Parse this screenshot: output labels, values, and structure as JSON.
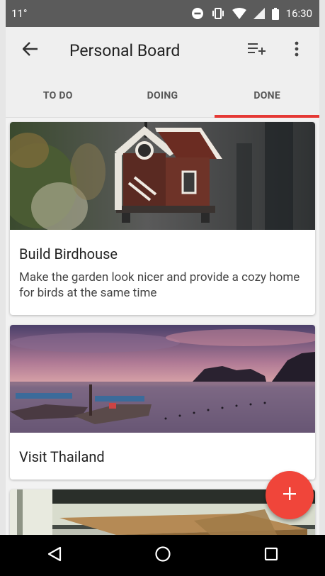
{
  "status_bar": {
    "temperature": "11°",
    "time": "16:30",
    "icons": [
      "do-not-disturb-icon",
      "vibrate-icon",
      "wifi-icon",
      "signal-icon",
      "battery-icon"
    ]
  },
  "app_bar": {
    "title": "Personal Board",
    "icons": [
      "back-arrow-icon",
      "playlist-add-icon",
      "more-vert-icon"
    ]
  },
  "tabs": [
    {
      "label": "TO DO",
      "active": false
    },
    {
      "label": "DOING",
      "active": false
    },
    {
      "label": "DONE",
      "active": true
    }
  ],
  "cards": [
    {
      "title": "Build Birdhouse",
      "description": "Make the garden look nicer and provide a cozy home for birds at the same time",
      "image": "birdhouse-photo"
    },
    {
      "title": "Visit Thailand",
      "description": "",
      "image": "thailand-boats-photo"
    },
    {
      "title": "",
      "description": "",
      "image": "patio-table-photo"
    }
  ],
  "fab": {
    "icon": "plus-icon"
  },
  "nav_bar": {
    "icons": [
      "back-triangle-icon",
      "home-circle-icon",
      "recents-square-icon"
    ]
  },
  "colors": {
    "accent": "#e53935",
    "fab": "#f0453a",
    "status_bar": "#5b5b5b",
    "app_bar": "#efefef",
    "nav_bar": "#000000"
  }
}
